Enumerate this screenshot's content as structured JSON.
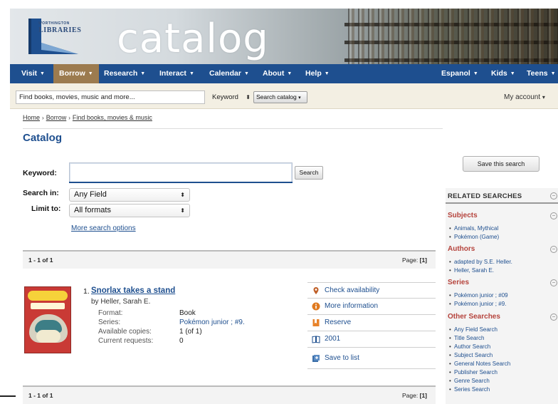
{
  "banner": {
    "logo_small": "WORTHINGTON",
    "logo_big": "LIBRARIES",
    "wordmark": "catalog"
  },
  "nav": {
    "items": [
      {
        "label": "Visit",
        "caret": "▼"
      },
      {
        "label": "Borrow",
        "caret": "▼"
      },
      {
        "label": "Research",
        "caret": "▼"
      },
      {
        "label": "Interact",
        "caret": "▼"
      },
      {
        "label": "Calendar",
        "caret": "▼"
      },
      {
        "label": "About",
        "caret": "▼"
      },
      {
        "label": "Help",
        "caret": "▼"
      },
      {
        "label": "Espanol",
        "caret": "▼"
      },
      {
        "label": "Kids",
        "caret": "▼"
      },
      {
        "label": "Teens",
        "caret": "▼"
      }
    ],
    "active": "Borrow",
    "colors": {
      "bar": "#1e4f8f",
      "active": "#9c7b4f"
    }
  },
  "searchbar": {
    "placeholder": "Find books, movies, music and more...",
    "type_select": "Keyword",
    "button_label": "Search catalog",
    "my_account": "My account"
  },
  "breadcrumb": [
    "Home",
    "Borrow",
    "Find books, movies & music"
  ],
  "page_title": "Catalog",
  "form": {
    "keyword_label": "Keyword:",
    "keyword_value": "",
    "search_button": "Search",
    "search_in_label": "Search in:",
    "search_in_value": "Any Field",
    "limit_to_label": "Limit to:",
    "limit_to_value": "All formats",
    "more_options": "More search options"
  },
  "results": {
    "count_text": "1 - 1 of 1",
    "page_label": "Page:",
    "page_value": "[1]",
    "item": {
      "number": "1.",
      "title": "Snorlax takes a stand",
      "author": "by Heller, Sarah E.",
      "fields": [
        {
          "label": "Format:",
          "value": "Book",
          "link": false
        },
        {
          "label": "Series:",
          "value": "Pokémon junior ; #9.",
          "link": true
        },
        {
          "label": "Available copies:",
          "value": "1 (of 1)",
          "link": false
        },
        {
          "label": "Current requests:",
          "value": "0",
          "link": false
        }
      ],
      "actions": [
        {
          "label": "Check availability",
          "icon": "pin-icon"
        },
        {
          "label": "More information",
          "icon": "info-icon"
        },
        {
          "label": "Reserve",
          "icon": "bookmark-icon"
        },
        {
          "label": "2001",
          "icon": "book-icon"
        },
        {
          "label": "Save to list",
          "icon": "save-list-icon"
        }
      ]
    }
  },
  "sidebar": {
    "save_button": "Save this search",
    "related_heading": "RELATED SEARCHES",
    "sections": [
      {
        "title": "Subjects",
        "links": [
          "Animals, Mythical",
          "Pokémon (Game)"
        ]
      },
      {
        "title": "Authors",
        "links": [
          "adapted by S.E. Heller.",
          "Heller, Sarah E."
        ]
      },
      {
        "title": "Series",
        "links": [
          "Pokémon junior ; #09",
          "Pokémon junior ; #9."
        ]
      },
      {
        "title": "Other Searches",
        "links": [
          "Any Field Search",
          "Title Search",
          "Author Search",
          "Subject Search",
          "General Notes Search",
          "Publisher Search",
          "Genre Search",
          "Series Search"
        ]
      }
    ]
  }
}
